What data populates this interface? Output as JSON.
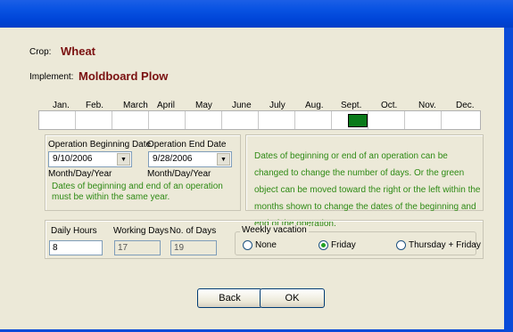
{
  "crop": {
    "label": "Crop:",
    "value": "Wheat"
  },
  "implement": {
    "label": "Implement:",
    "value": "Moldboard Plow"
  },
  "months": [
    "Jan.",
    "Feb.",
    "March",
    "April",
    "May",
    "June",
    "July",
    "Aug.",
    "Sept.",
    "Oct.",
    "Nov.",
    "Dec."
  ],
  "operation": {
    "begin_label": "Operation Beginning Date",
    "begin_value": "9/10/2006",
    "end_label": "Operation End Date",
    "end_value": "9/28/2006",
    "format_label": "Month/Day/Year",
    "note": "Dates of beginning and end of an operation must be within the same year.",
    "help": "Dates of beginning or end of an operation can be changed to change the number of days. Or the green object can be moved toward the right or the left within the months shown to change the dates of the beginning and end of the operation."
  },
  "hours": {
    "daily_label": "Daily Hours",
    "daily_value": "8",
    "working_label": "Working Days",
    "working_value": "17",
    "nodays_label": "No. of Days",
    "nodays_value": "19"
  },
  "vacation": {
    "legend": "Weekly vacation",
    "options": [
      "None",
      "Friday",
      "Thursday + Friday"
    ],
    "selected": "Friday"
  },
  "buttons": {
    "back": "Back",
    "ok": "OK"
  },
  "colors": {
    "titlebar": "#0a54e3",
    "crop_value": "#7a1010",
    "help_text": "#2e8a14",
    "selected_marker": "#0a7a1a"
  }
}
